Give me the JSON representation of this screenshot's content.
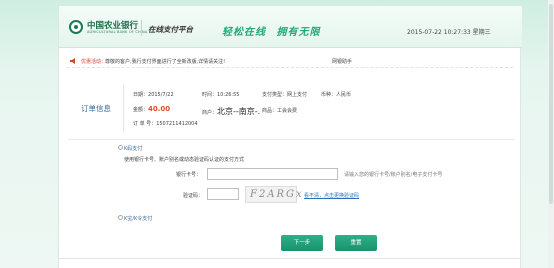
{
  "header": {
    "bank_name": "中国农业银行",
    "bank_name_en": "AGRICULTURAL BANK OF CHINA",
    "platform": "在线支付平台",
    "slogan_left": "轻松在线",
    "slogan_right": "拥有无限",
    "datetime": "2015-07-22 10:27:33 星期三"
  },
  "notice": {
    "label": "优惠活动：",
    "text": "尊敬的客户,我行支付界面进行了全新改版,详情请关注!",
    "link": "网银助手"
  },
  "order": {
    "title": "订单信息",
    "date_label": "日期：",
    "date": "2015/7/22",
    "time_label": "时间：",
    "time": "10:26:55",
    "pay_type_label": "支付类型：",
    "pay_type": "网上支付",
    "currency_label": "币种：",
    "currency": "人民币",
    "amount_label": "金额：",
    "amount": "40.00",
    "merchant_label": "商户：",
    "merchant": "北京--南京-.",
    "goods_label": "商品：",
    "goods": "工会会费",
    "order_no_label": "订 单 号：",
    "order_no": "1507211412004"
  },
  "kpay": {
    "title": "K码支付",
    "description": "使用银行卡号、账户别名或动态验证码认证的支付方式",
    "card_label": "银行卡号：",
    "card_value": "",
    "card_hint": "请输入您的银行卡号/账户别名/电子支付卡号",
    "captcha_label": "验证码：",
    "captcha_value": "",
    "captcha_image_text": "F2ARGx",
    "captcha_refresh": "看不清，点击更换验证码"
  },
  "kbao": {
    "title": "K宝/K令支付"
  },
  "buttons": {
    "next": "下一步",
    "reset": "重置"
  },
  "colors": {
    "brand_green": "#1e7a53",
    "accent_green": "#23a77a",
    "amount_red": "#e14b2b",
    "button_green": "#17936d"
  }
}
